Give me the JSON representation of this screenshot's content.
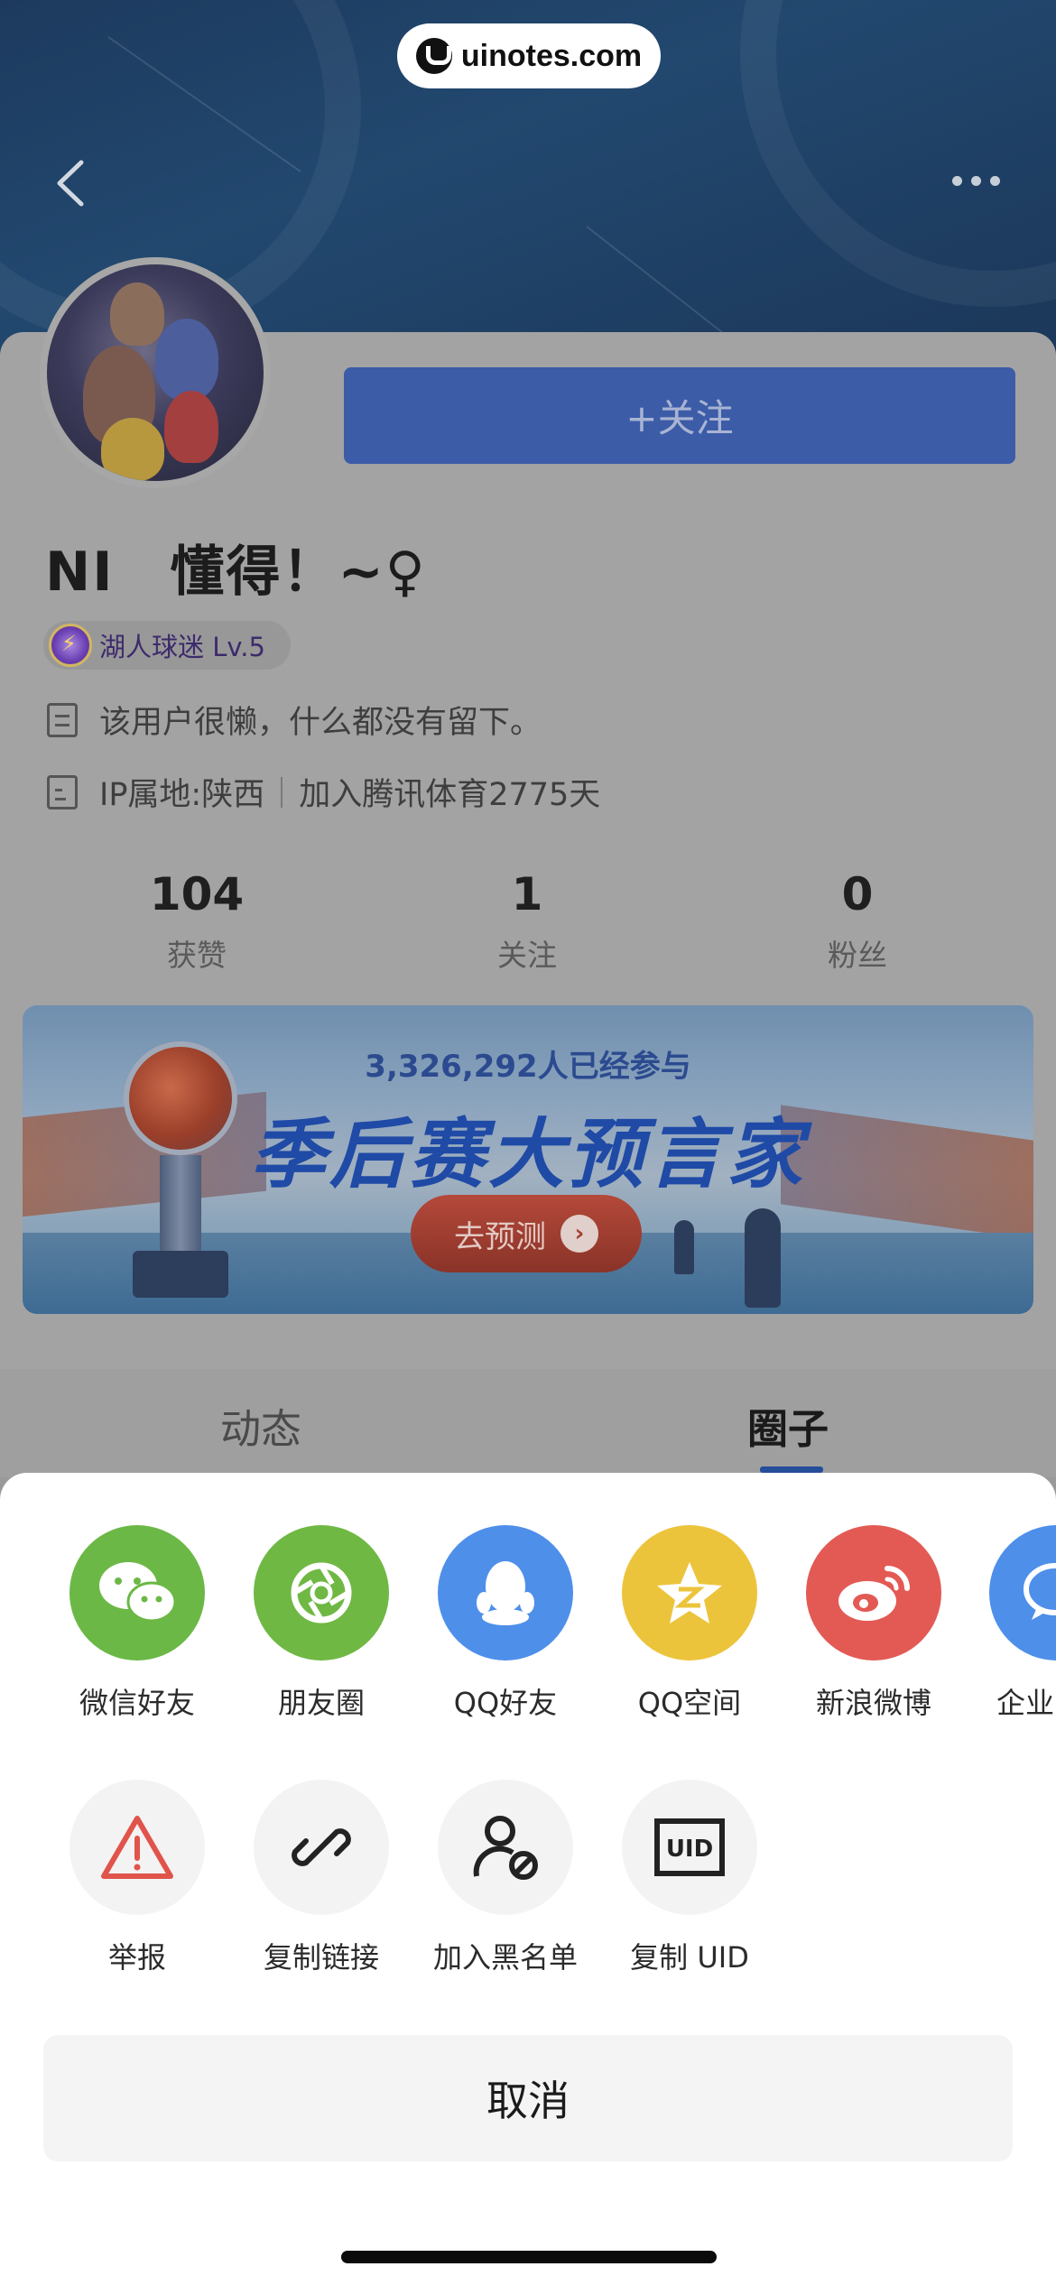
{
  "watermark": {
    "text": "uinotes.com"
  },
  "header": {
    "back_icon": "chevron-left-icon",
    "more_icon": "more-horizontal-icon"
  },
  "profile": {
    "follow_label": "+关注",
    "username": "NI　懂得！~♀",
    "badge_label": "湖人球迷 Lv.5",
    "bio": "该用户很懒，什么都没有留下。",
    "ip_location": "IP属地:陕西",
    "join_info": "加入腾讯体育2775天"
  },
  "stats": [
    {
      "value": "104",
      "label": "获赞"
    },
    {
      "value": "1",
      "label": "关注"
    },
    {
      "value": "0",
      "label": "粉丝"
    }
  ],
  "banner": {
    "participants": "3,326,292人已经参与",
    "title": "季后赛大预言家",
    "cta": "去预测"
  },
  "tabs": [
    {
      "label": "动态",
      "active": false
    },
    {
      "label": "圈子",
      "active": true
    }
  ],
  "share": {
    "targets": [
      {
        "label": "微信好友",
        "icon": "wechat-icon",
        "color": "#6bb846"
      },
      {
        "label": "朋友圈",
        "icon": "moments-icon",
        "color": "#6fb844"
      },
      {
        "label": "QQ好友",
        "icon": "qq-icon",
        "color": "#4e8fea"
      },
      {
        "label": "QQ空间",
        "icon": "qzone-icon",
        "color": "#ecc43c"
      },
      {
        "label": "新浪微博",
        "icon": "weibo-icon",
        "color": "#e35a55"
      },
      {
        "label": "企业",
        "icon": "enterprise-wechat-icon",
        "color": "#4e8fea"
      }
    ],
    "tools": [
      {
        "label": "举报",
        "icon": "warning-icon"
      },
      {
        "label": "复制链接",
        "icon": "link-icon"
      },
      {
        "label": "加入黑名单",
        "icon": "block-user-icon"
      },
      {
        "label": "复制 UID",
        "icon": "uid-icon"
      }
    ],
    "cancel_label": "取消"
  }
}
